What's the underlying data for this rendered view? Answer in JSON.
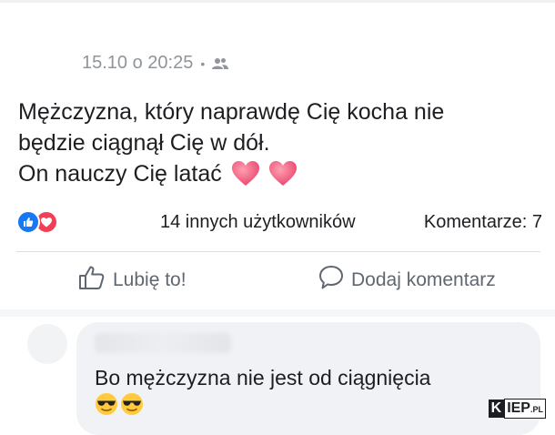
{
  "post": {
    "timestamp": "15.10 o 20:25",
    "separator": "•",
    "audience_icon": "friends-icon",
    "text_lines": [
      "Mężczyzna, który naprawdę Cię kocha nie",
      "będzie ciągnął Cię w dół.",
      "On nauczy Cię latać"
    ],
    "text_emoji": [
      "heart-emoji",
      "heart-emoji"
    ],
    "reactions": {
      "icons": [
        "like-reaction-icon",
        "love-reaction-icon"
      ],
      "count_label": "14 innych użytkowników",
      "comments_label": "Komentarze: 7"
    },
    "actions": {
      "like_label": "Lubię to!",
      "comment_label": "Dodaj komentarz"
    }
  },
  "comment": {
    "text": "Bo mężczyzna nie jest od ciągnięcia",
    "emoji": [
      "sunglasses-emoji",
      "sunglasses-emoji"
    ]
  },
  "watermark": {
    "k": "K",
    "rest": "IEP",
    "suffix": ".PL"
  },
  "colors": {
    "like_blue": "#1877f2",
    "love_red": "#f33e58",
    "heart_pink": "#f25c7a",
    "muted_text": "#90949c"
  }
}
